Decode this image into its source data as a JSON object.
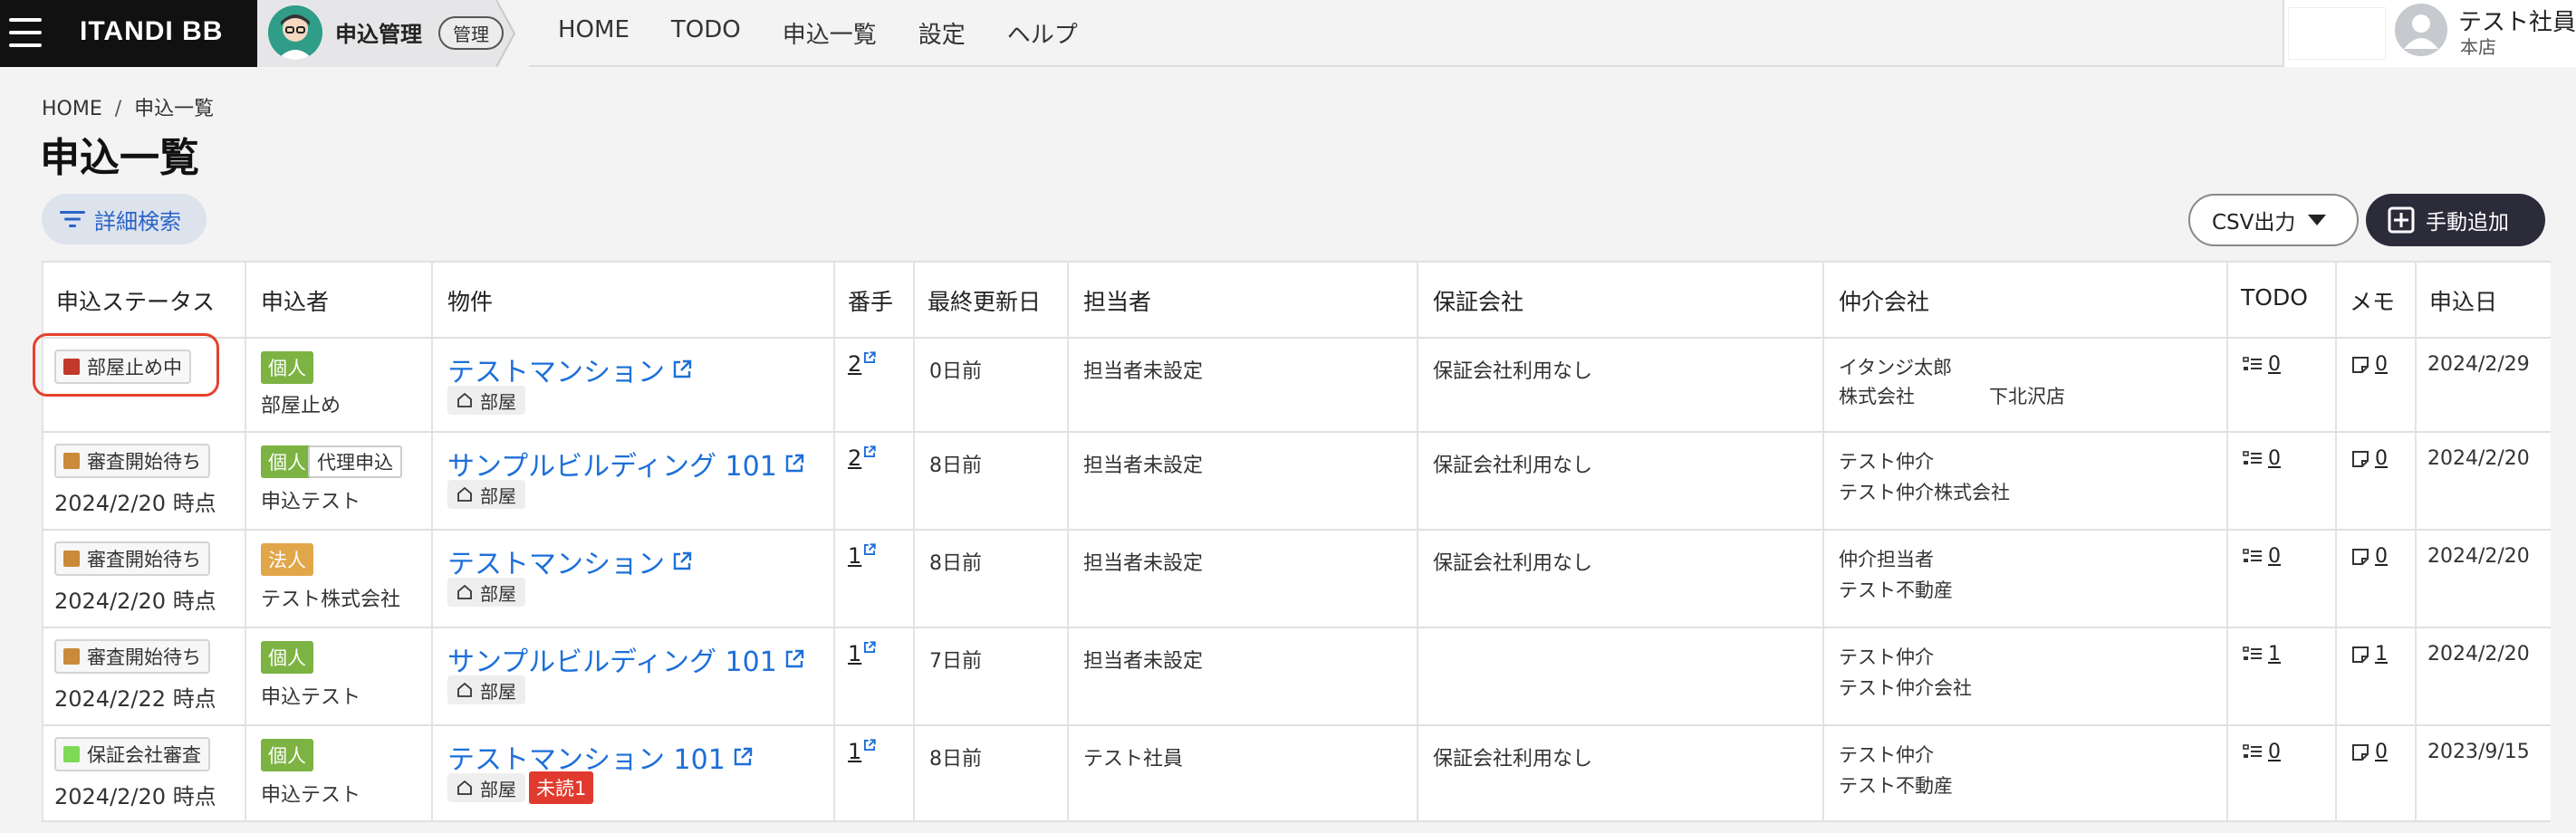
{
  "topbar": {
    "logo": "ITANDI BB",
    "app_title": "申込管理",
    "admin_badge": "管理",
    "nav": [
      "HOME",
      "TODO",
      "申込一覧",
      "設定",
      "ヘルプ"
    ],
    "user_name": "テスト社員",
    "user_branch": "本店"
  },
  "breadcrumb": {
    "home": "HOME",
    "sep": "/",
    "current": "申込一覧"
  },
  "page_title": "申込一覧",
  "toolbar": {
    "search_label": "詳細検索",
    "csv_label": "CSV出力",
    "add_label": "手動追加"
  },
  "table": {
    "headers": [
      "申込ステータス",
      "申込者",
      "物件",
      "番手",
      "最終更新日",
      "担当者",
      "保証会社",
      "仲介会社",
      "TODO",
      "メモ",
      "申込日"
    ],
    "room_label": "部屋",
    "rows": [
      {
        "status": "部屋止め中",
        "status_color": "#c0392b",
        "status_sub": "",
        "applicant_type": "個人",
        "applicant_type_color": "#7cb342",
        "applicant_extra": "",
        "applicant_name": "部屋止め",
        "property": "テストマンション",
        "unread": "",
        "bante": "2",
        "updated": "0日前",
        "staff": "担当者未設定",
        "guarantor": "保証会社利用なし",
        "broker_line1": "イタンジ太郎",
        "broker_line2": "株式会社",
        "broker_line2b": "下北沢店",
        "todo": "0",
        "memo": "0",
        "date": "2024/2/29"
      },
      {
        "status": "審査開始待ち",
        "status_color": "#c98a3a",
        "status_sub": "2024/2/20 時点",
        "applicant_type": "個人",
        "applicant_type_color": "#7cb342",
        "applicant_extra": "代理申込",
        "applicant_name": "申込テスト",
        "property": "サンプルビルディング 101",
        "unread": "",
        "bante": "2",
        "updated": "8日前",
        "staff": "担当者未設定",
        "guarantor": "保証会社利用なし",
        "broker_line1": "テスト仲介",
        "broker_line2": "テスト仲介株式会社",
        "broker_line2b": "",
        "todo": "0",
        "memo": "0",
        "date": "2024/2/20"
      },
      {
        "status": "審査開始待ち",
        "status_color": "#c98a3a",
        "status_sub": "2024/2/20 時点",
        "applicant_type": "法人",
        "applicant_type_color": "#e2a64a",
        "applicant_extra": "",
        "applicant_name": "テスト株式会社",
        "property": "テストマンション",
        "unread": "",
        "bante": "1",
        "updated": "8日前",
        "staff": "担当者未設定",
        "guarantor": "保証会社利用なし",
        "broker_line1": "仲介担当者",
        "broker_line2": "テスト不動産",
        "broker_line2b": "",
        "todo": "0",
        "memo": "0",
        "date": "2024/2/20"
      },
      {
        "status": "審査開始待ち",
        "status_color": "#c98a3a",
        "status_sub": "2024/2/22 時点",
        "applicant_type": "個人",
        "applicant_type_color": "#7cb342",
        "applicant_extra": "",
        "applicant_name": "申込テスト",
        "property": "サンプルビルディング 101",
        "unread": "",
        "bante": "1",
        "updated": "7日前",
        "staff": "担当者未設定",
        "guarantor": "",
        "broker_line1": "テスト仲介",
        "broker_line2": "テスト仲介会社",
        "broker_line2b": "",
        "todo": "1",
        "memo": "1",
        "date": "2024/2/20"
      },
      {
        "status": "保証会社審査",
        "status_color": "#7ed957",
        "status_sub": "2024/2/20 時点",
        "applicant_type": "個人",
        "applicant_type_color": "#7cb342",
        "applicant_extra": "",
        "applicant_name": "申込テスト",
        "property": "テストマンション 101",
        "unread": "未読1",
        "bante": "1",
        "updated": "8日前",
        "staff": "テスト社員",
        "guarantor": "保証会社利用なし",
        "broker_line1": "テスト仲介",
        "broker_line2": "テスト不動産",
        "broker_line2b": "",
        "todo": "0",
        "memo": "0",
        "date": "2023/9/15"
      }
    ]
  }
}
